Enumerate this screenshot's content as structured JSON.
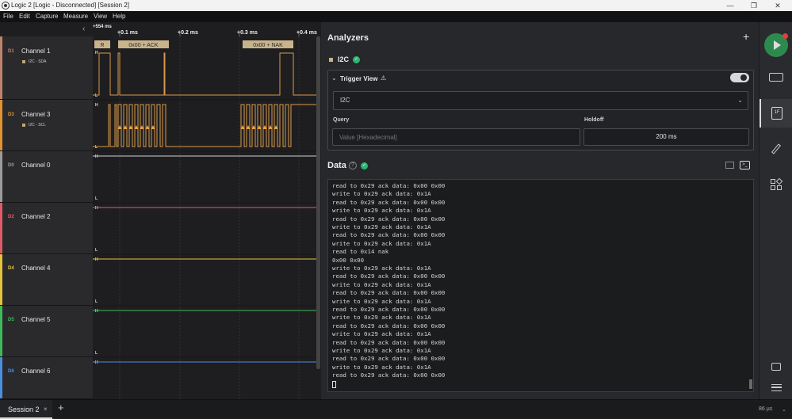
{
  "window": {
    "title": "Logic 2 [Logic - Disconnected] [Session 2]",
    "minimize": "—",
    "maximize": "❐",
    "close": "✕"
  },
  "menu": [
    "File",
    "Edit",
    "Capture",
    "Measure",
    "View",
    "Help"
  ],
  "timeline": {
    "offset": "+554 ms",
    "ticks": [
      "+0.1 ms",
      "+0.2 ms",
      "+0.3 ms",
      "+0.4 ms"
    ],
    "collapse_icon": "chevron-left-icon"
  },
  "channels": [
    {
      "id": "D1",
      "name": "Channel 1",
      "sub": "I2C - SDA",
      "color": "#c0826a"
    },
    {
      "id": "D3",
      "name": "Channel 3",
      "sub": "I2C - SCL",
      "color": "#e0922f"
    },
    {
      "id": "D0",
      "name": "Channel 0",
      "sub": "",
      "color": "#9b9b9b"
    },
    {
      "id": "D2",
      "name": "Channel 2",
      "sub": "",
      "color": "#e05a6a"
    },
    {
      "id": "D4",
      "name": "Channel 4",
      "sub": "",
      "color": "#e4c23b"
    },
    {
      "id": "D5",
      "name": "Channel 5",
      "sub": "",
      "color": "#3dbb5a"
    },
    {
      "id": "D6",
      "name": "Channel 6",
      "sub": "",
      "color": "#4a8fe0"
    }
  ],
  "annotations": {
    "r_label": "R",
    "ack_label": "0x00 + ACK",
    "nak_label": "0x00 + NAK",
    "high": "H",
    "low": "L"
  },
  "analyzers": {
    "title": "Analyzers",
    "add": "+",
    "analyzer_name": "I2C",
    "trigger_view": {
      "title": "Trigger View",
      "warn": "⚠",
      "select_value": "I2C",
      "query_label": "Query",
      "query_placeholder": "Value [Hexadecimal]",
      "holdoff_label": "Holdoff",
      "holdoff_value": "200 ms"
    }
  },
  "data": {
    "title": "Data",
    "help": "?",
    "lines": [
      "read to 0x29 ack data: 0x00 0x00",
      "write to 0x29 ack data: 0x1A",
      "read to 0x29 ack data: 0x00 0x00",
      "write to 0x29 ack data: 0x1A",
      "read to 0x29 ack data: 0x00 0x00",
      "write to 0x29 ack data: 0x1A",
      "read to 0x29 ack data: 0x00 0x00",
      "write to 0x29 ack data: 0x1A",
      "read to 0x14 nak",
      "0x00 0x00",
      "write to 0x29 ack data: 0x1A",
      "read to 0x29 ack data: 0x00 0x00",
      "write to 0x29 ack data: 0x1A",
      "read to 0x29 ack data: 0x00 0x00",
      "write to 0x29 ack data: 0x1A",
      "read to 0x29 ack data: 0x00 0x00",
      "write to 0x29 ack data: 0x1A",
      "read to 0x29 ack data: 0x00 0x00",
      "write to 0x29 ack data: 0x1A",
      "read to 0x29 ack data: 0x00 0x00",
      "write to 0x29 ack data: 0x1A",
      "read to 0x29 ack data: 0x00 0x00",
      "write to 0x29 ack data: 0x1A",
      "read to 0x29 ack data: 0x00 0x00"
    ]
  },
  "tabs": {
    "session": "Session 2",
    "close": "×",
    "add": "+",
    "status": "86 µs"
  },
  "colors": {
    "accent_green": "#2bb673",
    "trace": "#d89a4a",
    "marker": "#e8a23c"
  }
}
